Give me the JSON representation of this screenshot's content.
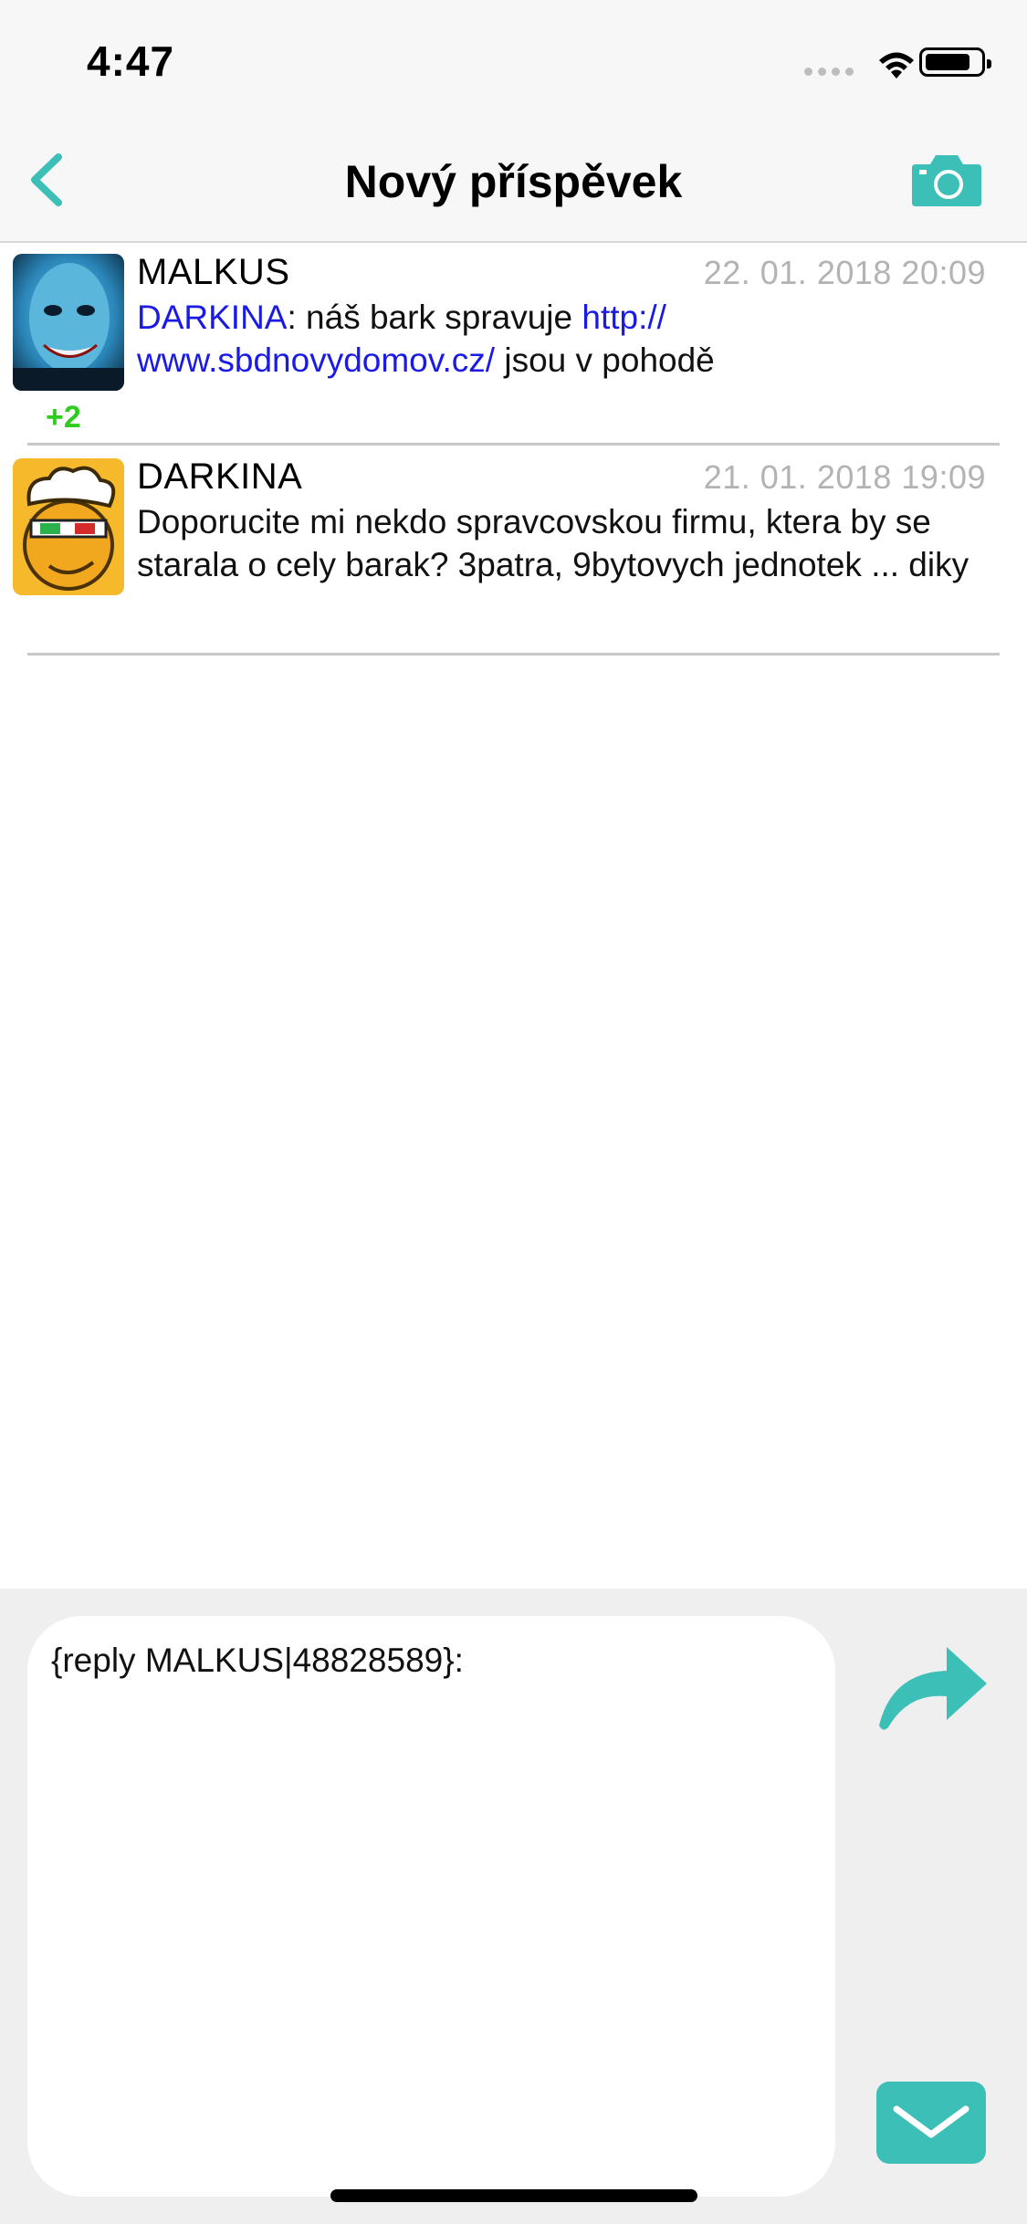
{
  "status_bar": {
    "time": "4:47"
  },
  "nav": {
    "title": "Nový příspěvek",
    "back_icon": "chevron-left-icon",
    "camera_icon": "camera-icon"
  },
  "accent_color": "#3bbfb7",
  "link_color": "#1a1ae6",
  "vote_color": "#2ecc1e",
  "posts": [
    {
      "author": "MALKUS",
      "date": "22. 01. 2018 20:09",
      "votes": "+2",
      "reply_to": "DARKINA",
      "body_before_link": ": náš bark spravuje ",
      "link_line1": "http://",
      "link_line2": "www.sbdnovydomov.cz/",
      "body_after_link": " jsou v pohodě"
    },
    {
      "author": "DARKINA",
      "date": "21. 01. 2018 19:09",
      "body": "Doporucite mi nekdo spravcovskou firmu, ktera by se starala o cely barak? 3patra, 9bytovych jednotek ... diky"
    }
  ],
  "compose": {
    "value": "{reply MALKUS|48828589}:",
    "share_icon": "share-arrow-icon",
    "mail_icon": "envelope-icon"
  }
}
